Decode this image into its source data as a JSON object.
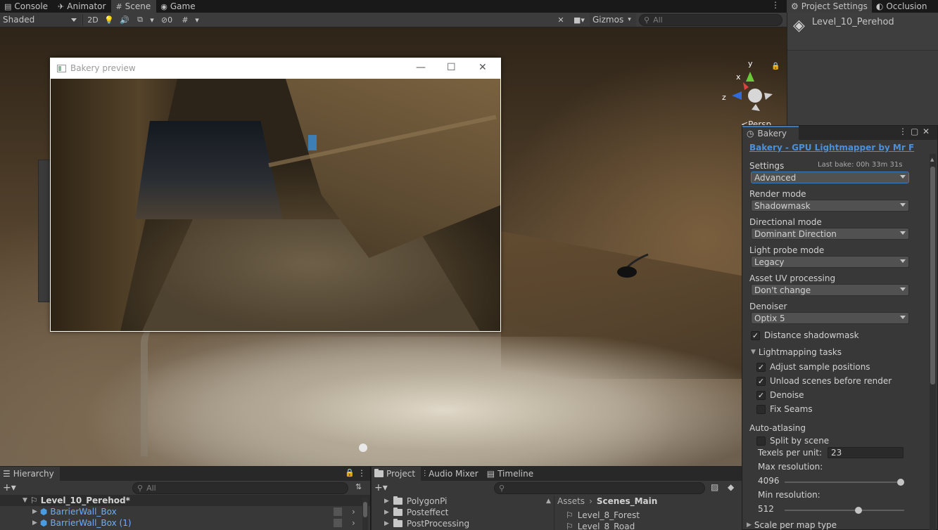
{
  "tabs": [
    {
      "icon": "console-icon",
      "label": "Console"
    },
    {
      "icon": "animator-icon",
      "label": "Animator"
    },
    {
      "icon": "scene-grid-icon",
      "label": "Scene"
    },
    {
      "icon": "game-controller-icon",
      "label": "Game"
    }
  ],
  "scene_toolbar": {
    "shading": "Shaded",
    "mode_2d": "2D",
    "hidden_count": "0",
    "gizmos": "Gizmos",
    "search_placeholder": "All"
  },
  "viewport": {
    "persp_label": "Persp",
    "axis_y": "y",
    "axis_x": "x",
    "axis_z": "z"
  },
  "preview_window": {
    "title": "Bakery preview",
    "minimize": "—",
    "maximize": "☐",
    "close": "✕"
  },
  "inspector": {
    "tabs": [
      {
        "icon": "gear-icon",
        "label": "Project Settings"
      },
      {
        "icon": "occlusion-icon",
        "label": "Occlusion"
      }
    ],
    "object_name": "Level_10_Perehod"
  },
  "bakery": {
    "tab_label": "Bakery",
    "link": "Bakery - GPU Lightmapper by Mr F",
    "settings_label": "Settings",
    "last_bake": "Last bake: 00h 33m 31s",
    "settings_value": "Advanced",
    "render_mode_label": "Render mode",
    "render_mode_value": "Shadowmask",
    "directional_mode_label": "Directional mode",
    "directional_mode_value": "Dominant Direction",
    "light_probe_label": "Light probe mode",
    "light_probe_value": "Legacy",
    "asset_uv_label": "Asset UV processing",
    "asset_uv_value": "Don't change",
    "denoiser_label": "Denoiser",
    "denoiser_value": "Optix 5",
    "distance_shadowmask": {
      "label": "Distance shadowmask",
      "checked": true
    },
    "lightmapping_tasks": "Lightmapping tasks",
    "tasks": [
      {
        "label": "Adjust sample positions",
        "checked": true
      },
      {
        "label": "Unload scenes before render",
        "checked": true
      },
      {
        "label": "Denoise",
        "checked": true
      },
      {
        "label": "Fix Seams",
        "checked": false
      }
    ],
    "auto_atlasing": "Auto-atlasing",
    "split_by_scene": {
      "label": "Split by scene",
      "checked": false
    },
    "texels_label": "Texels per unit:",
    "texels_value": "23",
    "max_res_label": "Max resolution:",
    "max_res_value": "4096",
    "max_res_fraction": 0.97,
    "min_res_label": "Min resolution:",
    "min_res_value": "512",
    "min_res_fraction": 0.62,
    "scale_per_map": "Scale per map type"
  },
  "hierarchy": {
    "tab_label": "Hierarchy",
    "search_placeholder": "All",
    "scene_root": "Level_10_Perehod*",
    "items": [
      "BarrierWall_Box",
      "BarrierWall_Box (1)"
    ]
  },
  "project": {
    "tabs": [
      {
        "icon": "folder-icon",
        "label": "Project"
      },
      {
        "icon": "audio-mixer-icon",
        "label": "Audio Mixer"
      },
      {
        "icon": "timeline-icon",
        "label": "Timeline"
      }
    ],
    "folders": [
      "PolygonPi",
      "Posteffect",
      "PostProcessing"
    ],
    "breadcrumb": [
      "Assets",
      "Scenes_Main"
    ],
    "files": [
      "Level_8_Forest",
      "Level_8_Road"
    ]
  }
}
